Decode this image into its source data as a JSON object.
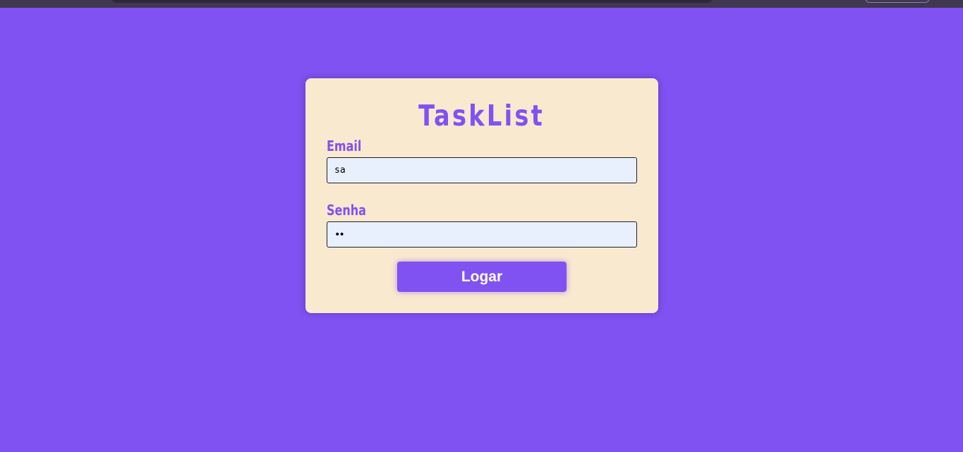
{
  "theme": {
    "background": "#8052f2",
    "card": "#f9e9cf",
    "accent": "#8052f2",
    "input_background": "#e8f0fe"
  },
  "login": {
    "title": "TaskList",
    "email_label": "Email",
    "email_value": "sa",
    "password_label": "Senha",
    "password_value": "••",
    "submit_label": "Logar"
  }
}
